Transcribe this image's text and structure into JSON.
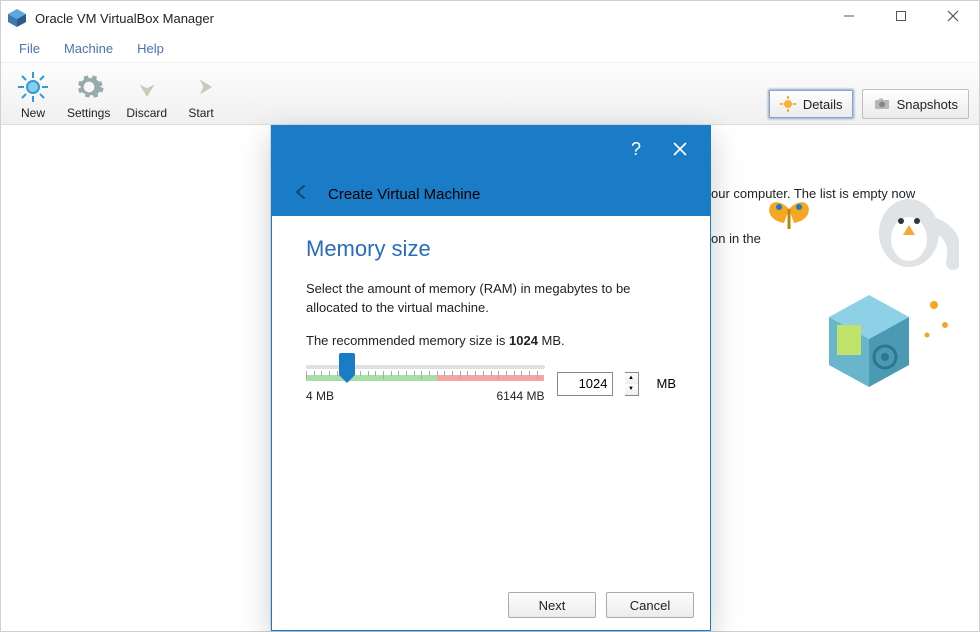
{
  "title": "Oracle VM VirtualBox Manager",
  "menu": {
    "file": "File",
    "machine": "Machine",
    "help": "Help"
  },
  "toolbar": {
    "new": "New",
    "settings": "Settings",
    "discard": "Discard",
    "start": "Start"
  },
  "right": {
    "details": "Details",
    "snapshots": "Snapshots"
  },
  "welcome": {
    "line1_tail": "our computer. The list is empty now",
    "line2_tail": "on in the"
  },
  "dialog": {
    "title": "Create Virtual Machine",
    "heading": "Memory size",
    "p1": "Select the amount of memory (RAM) in megabytes to be allocated to the virtual machine.",
    "rec_prefix": "The recommended memory size is ",
    "rec_value": "1024",
    "rec_suffix": " MB.",
    "min": "4 MB",
    "max": "6144 MB",
    "input": "1024",
    "unit": "MB",
    "next": "Next",
    "cancel": "Cancel"
  }
}
